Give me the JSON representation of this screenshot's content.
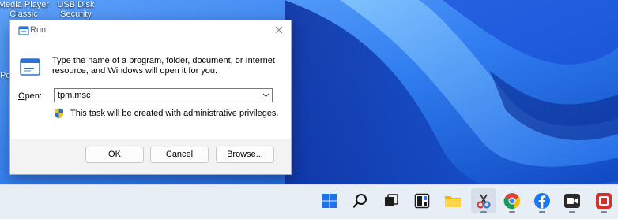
{
  "desktop": {
    "icons": [
      {
        "label_line1": "Media Player",
        "label_line2": "Classic"
      },
      {
        "label_line1": "USB Disk",
        "label_line2": "Security"
      }
    ],
    "edge_text": "Po"
  },
  "run_dialog": {
    "title": "Run",
    "description": "Type the name of a program, folder, document, or Internet resource, and Windows will open it for you.",
    "open_label_accel": "O",
    "open_label_rest": "pen:",
    "open_value": "tpm.msc",
    "admin_note": "This task will be created with administrative privileges.",
    "buttons": {
      "ok": "OK",
      "cancel": "Cancel",
      "browse_accel": "B",
      "browse_rest": "rowse..."
    }
  },
  "taskbar": {
    "items": [
      {
        "icon": "windows-start-icon"
      },
      {
        "icon": "search-icon"
      },
      {
        "icon": "task-view-icon"
      },
      {
        "icon": "widgets-icon"
      },
      {
        "icon": "file-explorer-icon"
      },
      {
        "icon": "snipping-tool-icon",
        "active": true
      },
      {
        "icon": "chrome-icon"
      },
      {
        "icon": "facebook-icon"
      },
      {
        "icon": "zoom-icon"
      },
      {
        "icon": "app-icon"
      }
    ]
  },
  "colors": {
    "accent": "#0067c0",
    "wallpaper_dark": "#0a2fa8",
    "wallpaper_light": "#5aa8ff"
  }
}
